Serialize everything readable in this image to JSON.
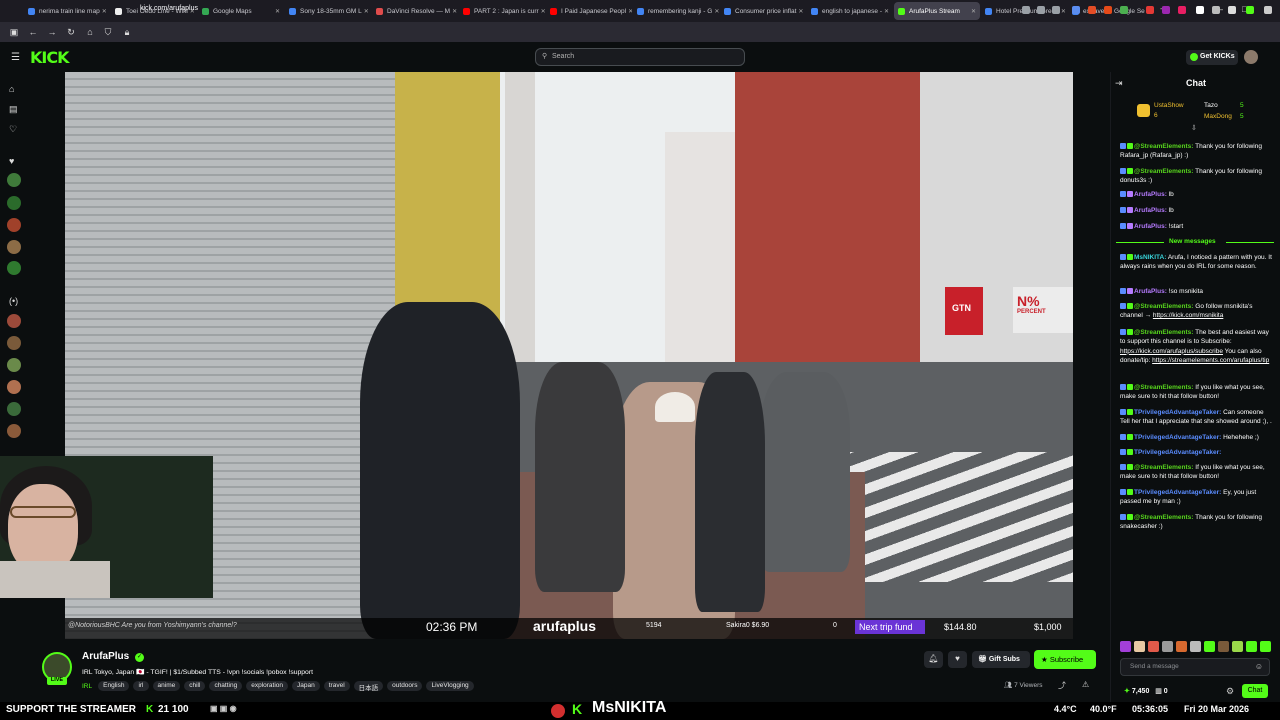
{
  "browser": {
    "tabs": [
      {
        "label": "nerima train line map",
        "color": "#4285f4",
        "active": false
      },
      {
        "label": "Toei Ōedo Line - Wiki",
        "color": "#eeeeee",
        "active": false
      },
      {
        "label": "Google Maps",
        "color": "#34a853",
        "active": false
      },
      {
        "label": "Sony 18-35mm GM L",
        "color": "#4285f4",
        "active": false
      },
      {
        "label": "DaVinci Resolve — M",
        "color": "#e04c4c",
        "active": false
      },
      {
        "label": "PART 2 : Japan is curr",
        "color": "#ff0000",
        "active": false
      },
      {
        "label": "I Paid Japanese Peopl",
        "color": "#ff0000",
        "active": false
      },
      {
        "label": "remembering kanji - G",
        "color": "#4285f4",
        "active": false
      },
      {
        "label": "Consumer price inflat",
        "color": "#4285f4",
        "active": false
      },
      {
        "label": "english to japanese -",
        "color": "#4285f4",
        "active": false
      },
      {
        "label": "ArufaPlus Stream",
        "color": "#53fc18",
        "active": true
      },
      {
        "label": "Hotel Premium Green",
        "color": "#4285f4",
        "active": false
      },
      {
        "label": "extravert - Google Se",
        "color": "#4285f4",
        "active": false
      }
    ],
    "url": "kick.com/arufaplus"
  },
  "site": {
    "logo": "KICK",
    "search_placeholder": "Search",
    "get_kicks": "Get KICKs"
  },
  "video": {
    "overlay_chat": "@NotoriousBHC Are you from Yoshimyann's channel?",
    "time": "02:36 PM",
    "channel_watermark": "arufaplus",
    "sub_count": "5194",
    "donor": "Sakira0 $6.90",
    "counter": "0",
    "goal_label": "Next trip fund",
    "goal_current": "$144.80",
    "goal_target": "$1,000",
    "street_sign_left": "GTN",
    "street_sign_right": "N%",
    "street_sign_right_sub": "PERCENT"
  },
  "stream": {
    "channel_name": "ArufaPlus",
    "live_badge": "LIVE",
    "title": "IRL Tokyo, Japan 🇯🇵 - TGIF! | $1/Subbed TTS - !vpn !socials !pobox !support",
    "category": "IRL",
    "tags": [
      "English",
      "irl",
      "anime",
      "chill",
      "chatting",
      "exploration",
      "Japan",
      "travel",
      "日本語",
      "outdoors",
      "LiveVlogging"
    ],
    "gift_subs": "Gift Subs",
    "subscribe": "Subscribe",
    "viewers": "7 Viewers"
  },
  "chat": {
    "title": "Chat",
    "leaderboard": [
      {
        "name": "UstaShow",
        "count": "6"
      },
      {
        "name": "Tazo",
        "count": "5"
      },
      {
        "name": "MaxDong",
        "count": "5"
      }
    ],
    "new_messages_label": "New messages",
    "messages": [
      {
        "user": "@StreamElements:",
        "cls": "g",
        "text": " Thank you for following Rafara_jp (Rafara_jp) :)"
      },
      {
        "user": "@StreamElements:",
        "cls": "g",
        "text": " Thank you for following donuts3s :)"
      },
      {
        "user": "ArufaPlus:",
        "cls": "p",
        "text": " lb"
      },
      {
        "user": "ArufaPlus:",
        "cls": "p",
        "text": " lb"
      },
      {
        "user": "ArufaPlus:",
        "cls": "p",
        "text": " !start"
      },
      {
        "user": "MsNIKITA:",
        "cls": "c",
        "text": " Arufa, I noticed a pattern with you. It always rains when you do IRL for some reason."
      },
      {
        "user": "ArufaPlus:",
        "cls": "p",
        "text": " !so msnikita"
      },
      {
        "user": "@StreamElements:",
        "cls": "g",
        "text": " Go follow msnikita's channel → ",
        "link": "https://kick.com/msnikita"
      },
      {
        "user": "@StreamElements:",
        "cls": "g",
        "text": " The best and easiest way to support this channel is to Subscribe: ",
        "link": "https://kick.com/arufaplus/subscribe",
        "text2": " You can also donate/tip: ",
        "link2": "https://streamelements.com/arufaplus/tip"
      },
      {
        "user": "@StreamElements:",
        "cls": "g",
        "text": " If you like what you see, make sure to hit that follow button!"
      },
      {
        "user": "TPrivilegedAdvantageTaker:",
        "cls": "b",
        "text": " Can someone Tell her that I appreciate that she showed around ;), ."
      },
      {
        "user": "TPrivilegedAdvantageTaker:",
        "cls": "b",
        "text": " Hehehehe ;)"
      },
      {
        "user": "TPrivilegedAdvantageTaker:",
        "cls": "b",
        "text": ""
      },
      {
        "user": "@StreamElements:",
        "cls": "g",
        "text": " If you like what you see, make sure to hit that follow button!"
      },
      {
        "user": "TPrivilegedAdvantageTaker:",
        "cls": "b",
        "text": " Ey, you just passed me by man ;)"
      },
      {
        "user": "@StreamElements:",
        "cls": "g",
        "text": " Thank you for following snakecasher :)"
      }
    ],
    "input_placeholder": "Send a message",
    "points": "7,450",
    "points2": "0",
    "chat_button": "Chat"
  },
  "taskbar": {
    "support": "SUPPORT THE STREAMER",
    "left_stats": "21 100",
    "brand": "MsNIKITA",
    "temp": "4.4°C",
    "temp2": "40.0°F",
    "clock": "05:36:05",
    "date": "Fri 20 Mar 2026"
  }
}
